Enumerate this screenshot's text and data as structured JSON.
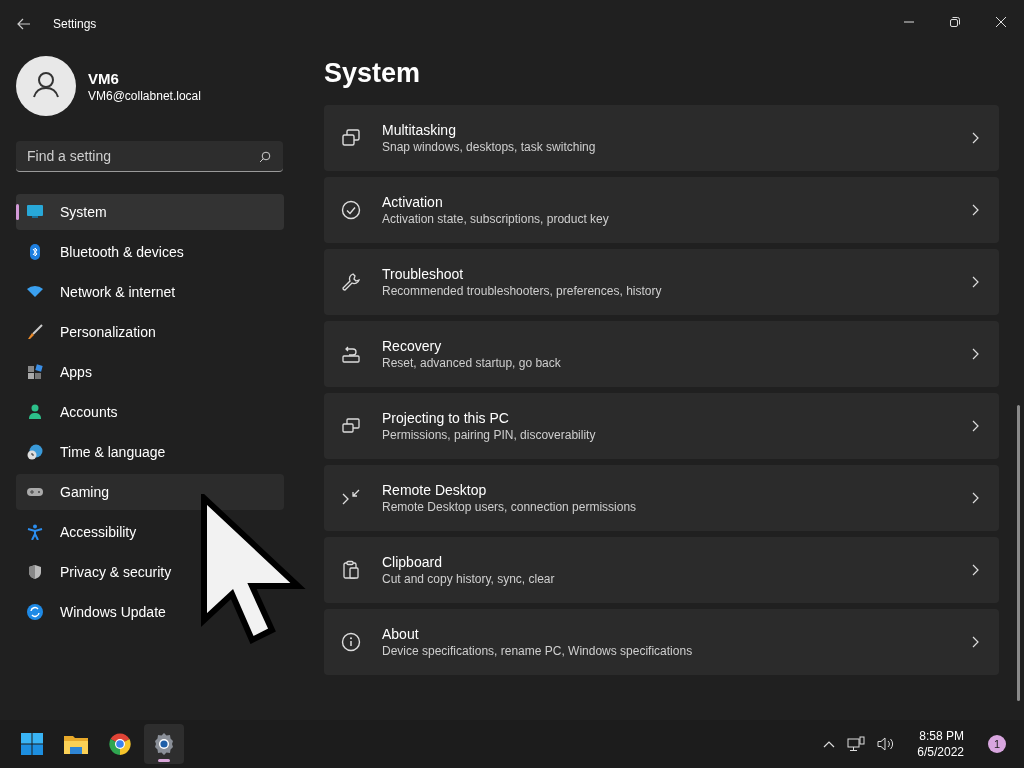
{
  "window": {
    "title": "Settings"
  },
  "profile": {
    "name": "VM6",
    "email": "VM6@collabnet.local"
  },
  "search": {
    "placeholder": "Find a setting"
  },
  "nav": [
    {
      "label": "System",
      "selected": true,
      "hovered": false
    },
    {
      "label": "Bluetooth & devices",
      "selected": false,
      "hovered": false
    },
    {
      "label": "Network & internet",
      "selected": false,
      "hovered": false
    },
    {
      "label": "Personalization",
      "selected": false,
      "hovered": false
    },
    {
      "label": "Apps",
      "selected": false,
      "hovered": false
    },
    {
      "label": "Accounts",
      "selected": false,
      "hovered": false
    },
    {
      "label": "Time & language",
      "selected": false,
      "hovered": false
    },
    {
      "label": "Gaming",
      "selected": false,
      "hovered": true
    },
    {
      "label": "Accessibility",
      "selected": false,
      "hovered": false
    },
    {
      "label": "Privacy & security",
      "selected": false,
      "hovered": false
    },
    {
      "label": "Windows Update",
      "selected": false,
      "hovered": false
    }
  ],
  "page": {
    "title": "System"
  },
  "cards": [
    {
      "title": "Multitasking",
      "subtitle": "Snap windows, desktops, task switching"
    },
    {
      "title": "Activation",
      "subtitle": "Activation state, subscriptions, product key"
    },
    {
      "title": "Troubleshoot",
      "subtitle": "Recommended troubleshooters, preferences, history"
    },
    {
      "title": "Recovery",
      "subtitle": "Reset, advanced startup, go back"
    },
    {
      "title": "Projecting to this PC",
      "subtitle": "Permissions, pairing PIN, discoverability"
    },
    {
      "title": "Remote Desktop",
      "subtitle": "Remote Desktop users, connection permissions"
    },
    {
      "title": "Clipboard",
      "subtitle": "Cut and copy history, sync, clear"
    },
    {
      "title": "About",
      "subtitle": "Device specifications, rename PC, Windows specifications"
    }
  ],
  "taskbar": {
    "apps": [
      {
        "selected": false
      },
      {
        "selected": false
      },
      {
        "selected": false
      },
      {
        "selected": true
      }
    ],
    "time": "8:58 PM",
    "date": "6/5/2022",
    "notifications": "1"
  }
}
